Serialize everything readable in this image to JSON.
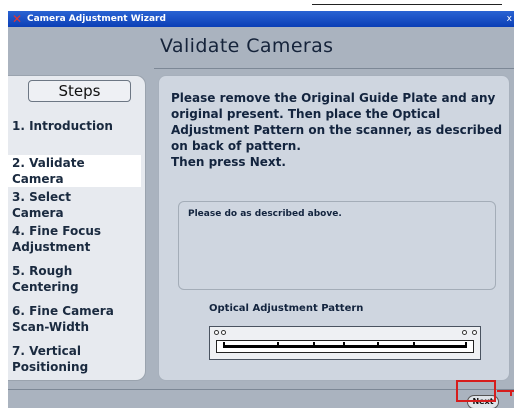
{
  "window": {
    "title": "Camera Adjustment Wizard",
    "close_glyph": "x",
    "app_icon": "wizard-x-icon"
  },
  "page": {
    "heading": "Validate Cameras"
  },
  "steps": {
    "header": "Steps",
    "items": [
      {
        "label": "1. Introduction",
        "active": false
      },
      {
        "label": "2. Validate\nCamera",
        "active": true
      },
      {
        "label": "3. Select\nCamera",
        "active": false
      },
      {
        "label": "4. Fine Focus\nAdjustment",
        "active": false
      },
      {
        "label": "5. Rough\nCentering",
        "active": false
      },
      {
        "label": "6. Fine Camera\nScan-Width",
        "active": false
      },
      {
        "label": "7. Vertical\nPositioning",
        "active": false
      }
    ]
  },
  "content": {
    "instructions": "Please remove the Original Guide Plate and any original present. Then place the Optical Adjustment Pattern on the scanner, as described on back of pattern.\nThen press Next.",
    "status": "Please do as described above.",
    "pattern_label": "Optical Adjustment Pattern"
  },
  "buttons": {
    "next": "Next"
  },
  "colors": {
    "titlebar": "#0b3fb6",
    "window_bg": "#aab3bf",
    "panel_bg": "#cfd6e0",
    "sidebar_bg": "#e7eaef",
    "highlight": "#d61c1c"
  }
}
